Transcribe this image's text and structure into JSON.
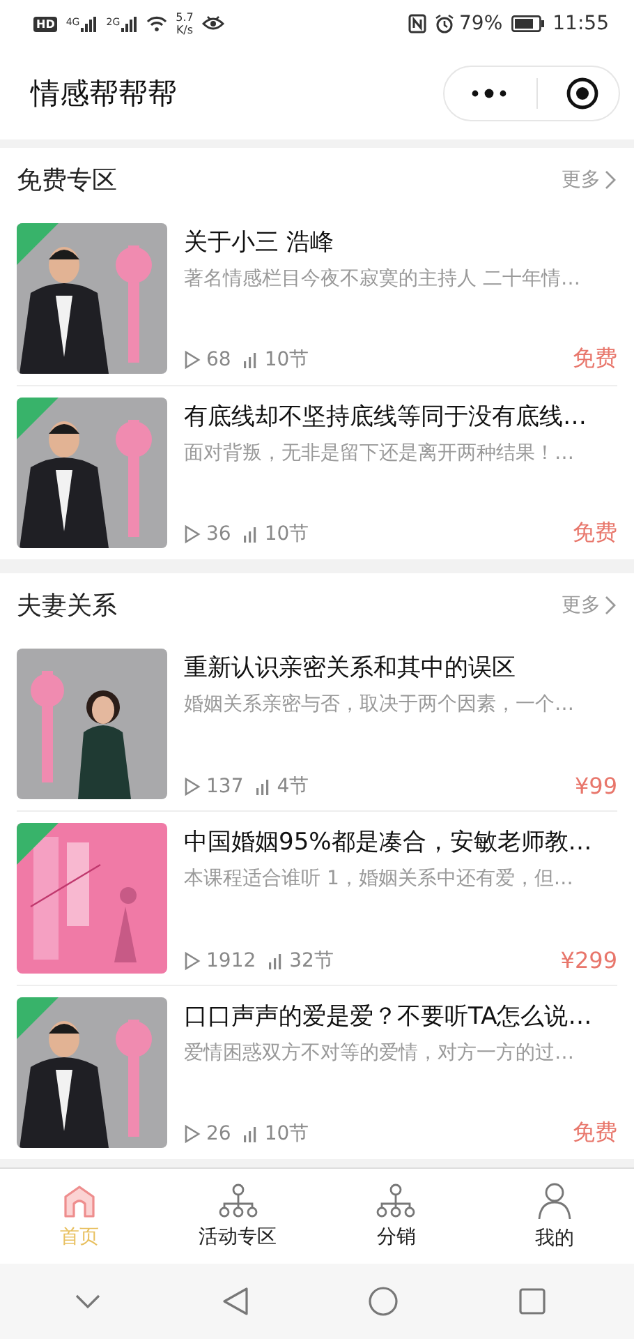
{
  "status_bar": {
    "hd_badge": "HD",
    "networks": [
      "4G",
      "2G"
    ],
    "speed": "5.7",
    "speed_unit": "K/s",
    "battery": "79%",
    "time": "11:55"
  },
  "header": {
    "title": "情感帮帮帮"
  },
  "sections": [
    {
      "title": "免费专区",
      "more": "更多",
      "courses": [
        {
          "title": "关于小三 浩峰",
          "description": "著名情感栏目今夜不寂寞的主持人 二十年情…",
          "plays": "68",
          "lessons": "10节",
          "price": "免费"
        },
        {
          "title": "有底线却不坚持底线等同于没有底线…",
          "description": "面对背叛，无非是留下还是离开两种结果！…",
          "plays": "36",
          "lessons": "10节",
          "price": "免费"
        }
      ]
    },
    {
      "title": "夫妻关系",
      "more": "更多",
      "courses": [
        {
          "title": "重新认识亲密关系和其中的误区",
          "description": "婚姻关系亲密与否，取决于两个因素，一个…",
          "plays": "137",
          "lessons": "4节",
          "price": "¥99"
        },
        {
          "title": "中国婚姻95%都是凑合，安敏老师教…",
          "description": "本课程适合谁听 1，婚姻关系中还有爱，但…",
          "plays": "1912",
          "lessons": "32节",
          "price": "¥299"
        },
        {
          "title": "口口声声的爱是爱？不要听TA怎么说…",
          "description": "爱情困惑双方不对等的爱情，对方一方的过…",
          "plays": "26",
          "lessons": "10节",
          "price": "免费"
        }
      ]
    }
  ],
  "tabs": [
    {
      "label": "首页",
      "kind": "house",
      "selected": true
    },
    {
      "label": "活动专区",
      "kind": "tree",
      "selected": false
    },
    {
      "label": "分销",
      "kind": "tree",
      "selected": false
    },
    {
      "label": "我的",
      "kind": "person",
      "selected": false
    }
  ]
}
